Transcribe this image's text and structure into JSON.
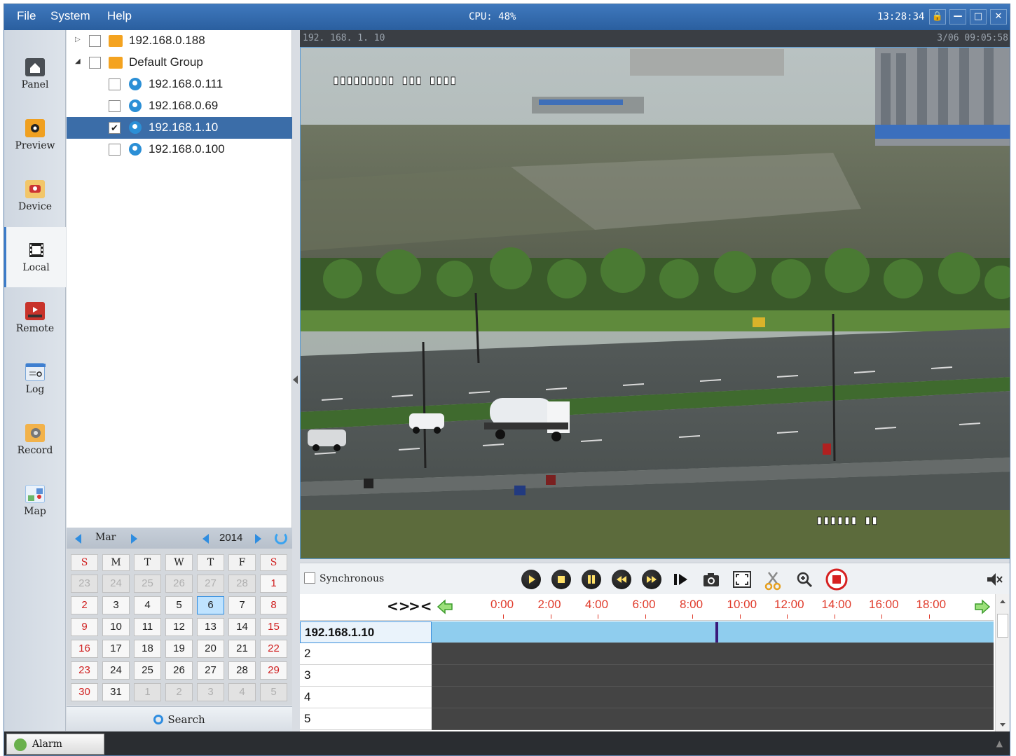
{
  "menu": {
    "file": "File",
    "system": "System",
    "help": "Help"
  },
  "status": {
    "cpu": "CPU: 48%",
    "clock": "13:28:34"
  },
  "nav": [
    {
      "label": "Panel",
      "icon": "home-icon"
    },
    {
      "label": "Preview",
      "icon": "camera-icon"
    },
    {
      "label": "Device",
      "icon": "device-icon"
    },
    {
      "label": "Local",
      "icon": "film-icon"
    },
    {
      "label": "Remote",
      "icon": "remote-icon"
    },
    {
      "label": "Log",
      "icon": "log-icon"
    },
    {
      "label": "Record",
      "icon": "record-icon"
    },
    {
      "label": "Map",
      "icon": "map-icon"
    }
  ],
  "tree": {
    "group1": "192.168.0.188",
    "group2": "Default Group",
    "devices": [
      "192.168.0.111",
      "192.168.0.69",
      "192.168.1.10",
      "192.168.0.100"
    ],
    "selected": "192.168.1.10"
  },
  "calendar": {
    "month": "Mar",
    "year": "2014",
    "days_of_week": [
      "S",
      "M",
      "T",
      "W",
      "T",
      "F",
      "S"
    ],
    "weeks": [
      [
        "23",
        "24",
        "25",
        "26",
        "27",
        "28",
        "1"
      ],
      [
        "2",
        "3",
        "4",
        "5",
        "6",
        "7",
        "8"
      ],
      [
        "9",
        "10",
        "11",
        "12",
        "13",
        "14",
        "15"
      ],
      [
        "16",
        "17",
        "18",
        "19",
        "20",
        "21",
        "22"
      ],
      [
        "23",
        "24",
        "25",
        "26",
        "27",
        "28",
        "29"
      ],
      [
        "30",
        "31",
        "1",
        "2",
        "3",
        "4",
        "5"
      ]
    ],
    "today": "6",
    "search": "Search"
  },
  "video": {
    "camera_ip": "192. 168. 1. 10",
    "timestamp": "3/06 09:05:58"
  },
  "controls": {
    "synchronous": "Synchronous"
  },
  "timeline": {
    "ticks": [
      "0:00",
      "2:00",
      "4:00",
      "6:00",
      "8:00",
      "10:00",
      "12:00",
      "14:00",
      "16:00",
      "18:00"
    ],
    "rows": [
      "192.168.1.10",
      "2",
      "3",
      "4",
      "5"
    ],
    "playhead_fraction": 0.505,
    "colors": {
      "recorded": "#8fcdee",
      "empty": "#444444",
      "tick": "#e03b2b"
    }
  },
  "statusbar": {
    "alarm": "Alarm"
  }
}
